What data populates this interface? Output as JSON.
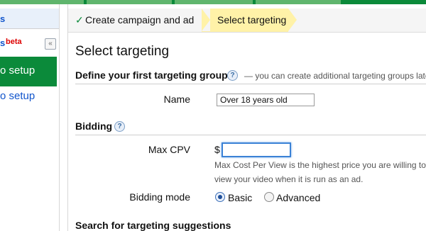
{
  "sidebar": {
    "crumb_label": "s",
    "section_letter": "s",
    "beta_badge": "beta",
    "collapse_glyph": "«",
    "active_item_label": "o setup",
    "link_item_label": "o setup"
  },
  "steps": {
    "step1_check": "✓",
    "step1_label": "Create campaign and ad",
    "step2_label": "Select targeting"
  },
  "page_title": "Select targeting",
  "targeting_group": {
    "title": "Define your first targeting group",
    "help": "?",
    "note": "— you can create additional targeting groups late",
    "name_label": "Name",
    "name_value": "Over 18 years old"
  },
  "bidding": {
    "title": "Bidding",
    "help": "?",
    "max_cpv_label": "Max CPV",
    "currency": "$",
    "max_cpv_value": "",
    "hint_line1": "Max Cost Per View is the highest price you are willing to",
    "hint_line2": "view your video when it is run as an ad.",
    "mode_label": "Bidding mode",
    "mode_basic": "Basic",
    "mode_advanced": "Advanced",
    "selected_mode": "Basic"
  },
  "suggestions": {
    "title": "Search for targeting suggestions"
  },
  "colors": {
    "brand_green": "#0b8a3a",
    "step_highlight": "#fff2a8",
    "link_blue": "#1155cc",
    "beta_red": "#dd0000",
    "focus_blue": "#3b82d6"
  }
}
